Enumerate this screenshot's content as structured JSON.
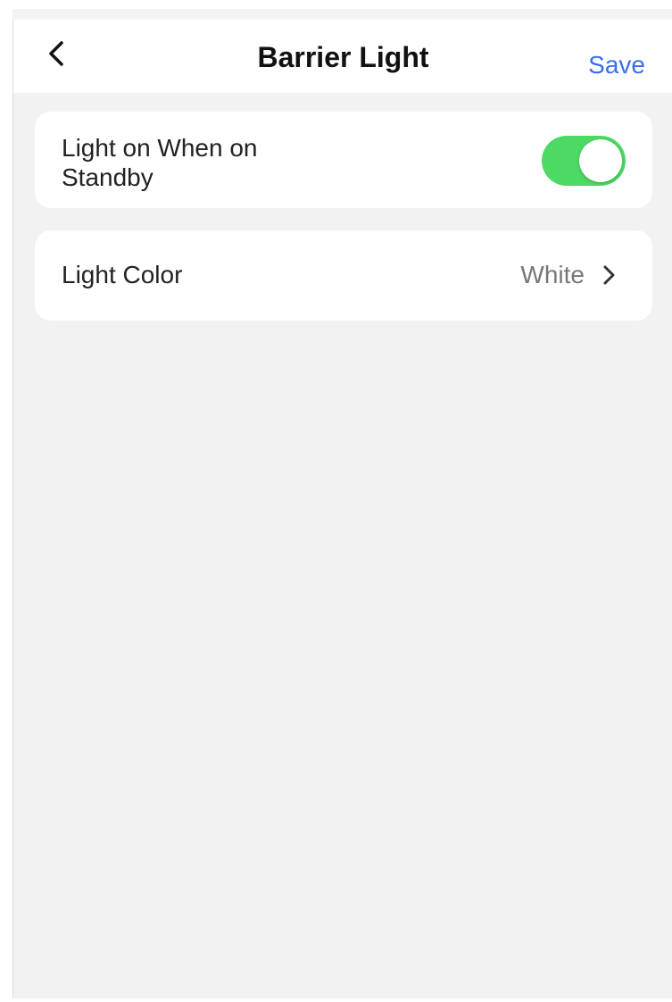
{
  "header": {
    "title": "Barrier Light",
    "save_label": "Save",
    "back_icon": "chevron-left-icon"
  },
  "settings": {
    "standby": {
      "label": "Light on When on Standby",
      "enabled": true,
      "toggle_color": "#4cd964"
    },
    "color": {
      "label": "Light Color",
      "value": "White",
      "icon": "chevron-right-icon"
    }
  },
  "colors": {
    "accent": "#3b6ef0",
    "background": "#f2f2f2",
    "card": "#ffffff"
  }
}
